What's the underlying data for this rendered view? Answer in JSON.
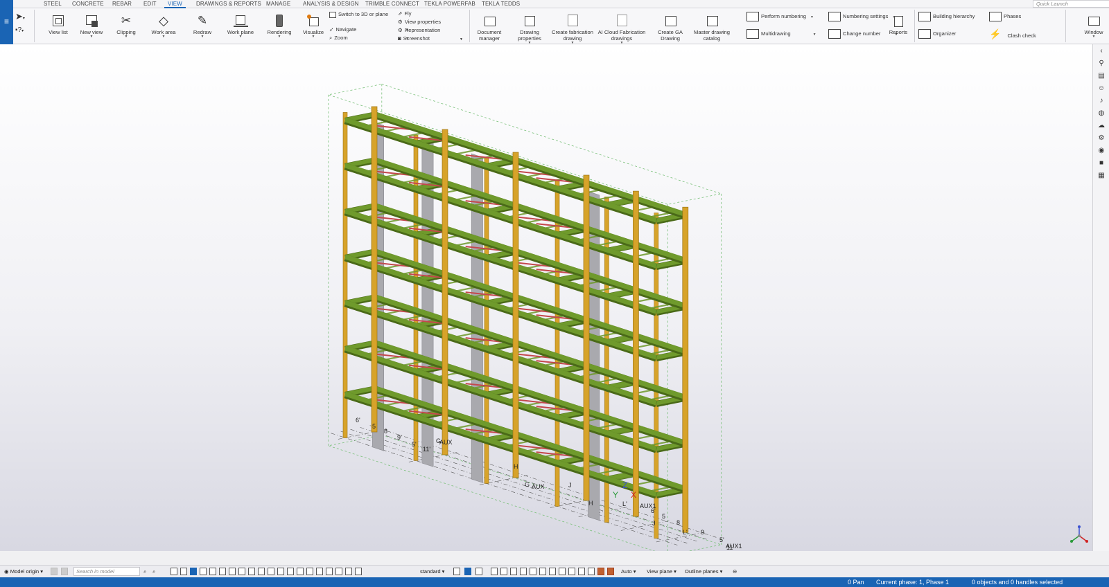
{
  "app": {
    "menu_icon": "hamburger-icon"
  },
  "tabs": [
    "STEEL",
    "CONCRETE",
    "REBAR",
    "EDIT",
    "VIEW",
    "DRAWINGS & REPORTS",
    "MANAGE",
    "ANALYSIS & DESIGN",
    "TRIMBLE CONNECT",
    "TEKLA POWERFAB",
    "TEKLA TEDDS"
  ],
  "active_tab": "VIEW",
  "quick_launch": {
    "placeholder": "Quick Launch"
  },
  "ribbon": {
    "view_list": "View list",
    "new_view": "New view",
    "clipping": "Clipping",
    "work_area": "Work area",
    "redraw": "Redraw",
    "work_plane": "Work plane",
    "rendering": "Rendering",
    "visualize": "Visualize",
    "switch_3d": "Switch to 3D or plane",
    "navigate": "Navigate",
    "zoom": "Zoom",
    "fly": "Fly",
    "view_properties": "View properties",
    "representation": "Representation",
    "screenshot": "Screenshot",
    "document_manager": [
      "Document",
      "manager"
    ],
    "drawing_properties": [
      "Drawing",
      "properties"
    ],
    "create_fabrication_drawing": [
      "Create fabrication",
      "drawing"
    ],
    "ai_cloud_fabrication": [
      "AI Cloud Fabrication",
      "drawings"
    ],
    "create_ga_drawing": [
      "Create GA",
      "Drawing"
    ],
    "master_drawing_catalog": [
      "Master drawing",
      "catalog"
    ],
    "perform_numbering": "Perform numbering",
    "multidrawing": "Multidrawing",
    "numbering_settings": "Numbering settings",
    "change_number": "Change number",
    "reports": "Reports",
    "building_hierarchy": "Building hierarchy",
    "organizer": "Organizer",
    "phases": "Phases",
    "clash_check": "Clash check",
    "window": "Window"
  },
  "grid_labels": [
    {
      "text": "6'"
    },
    {
      "text": "5"
    },
    {
      "text": "8"
    },
    {
      "text": "9'"
    },
    {
      "text": "5'"
    },
    {
      "text": "11'"
    },
    {
      "text": "G"
    },
    {
      "text": "AUX"
    },
    {
      "text": "G"
    },
    {
      "text": "AUX"
    },
    {
      "text": "H"
    },
    {
      "text": "H"
    },
    {
      "text": "J"
    },
    {
      "text": "J"
    },
    {
      "text": "L'"
    },
    {
      "text": "L'"
    },
    {
      "text": "AUX1"
    },
    {
      "text": "11'"
    },
    {
      "text": "5'"
    },
    {
      "text": "9"
    },
    {
      "text": "8"
    },
    {
      "text": "5"
    },
    {
      "text": "6'"
    },
    {
      "text": "AUX1"
    }
  ],
  "axis": {
    "z": "Z",
    "y": "Y",
    "x": "X"
  },
  "bottom": {
    "model_origin": "Model origin",
    "search_placeholder": "Search in model",
    "standard": "standard",
    "auto": "Auto",
    "view_plane": "View plane",
    "outline_planes": "Outline planes"
  },
  "status": {
    "pan": "0 Pan",
    "phase": "Current phase: 1, Phase 1",
    "selection": "0 objects and 0 handles selected"
  },
  "colors": {
    "accent": "#1a64b4",
    "beam_green": "#6f9a2c",
    "column_yellow": "#d7a32a",
    "brace_red": "#c4484d",
    "wall_gray": "#a9a9ae"
  }
}
